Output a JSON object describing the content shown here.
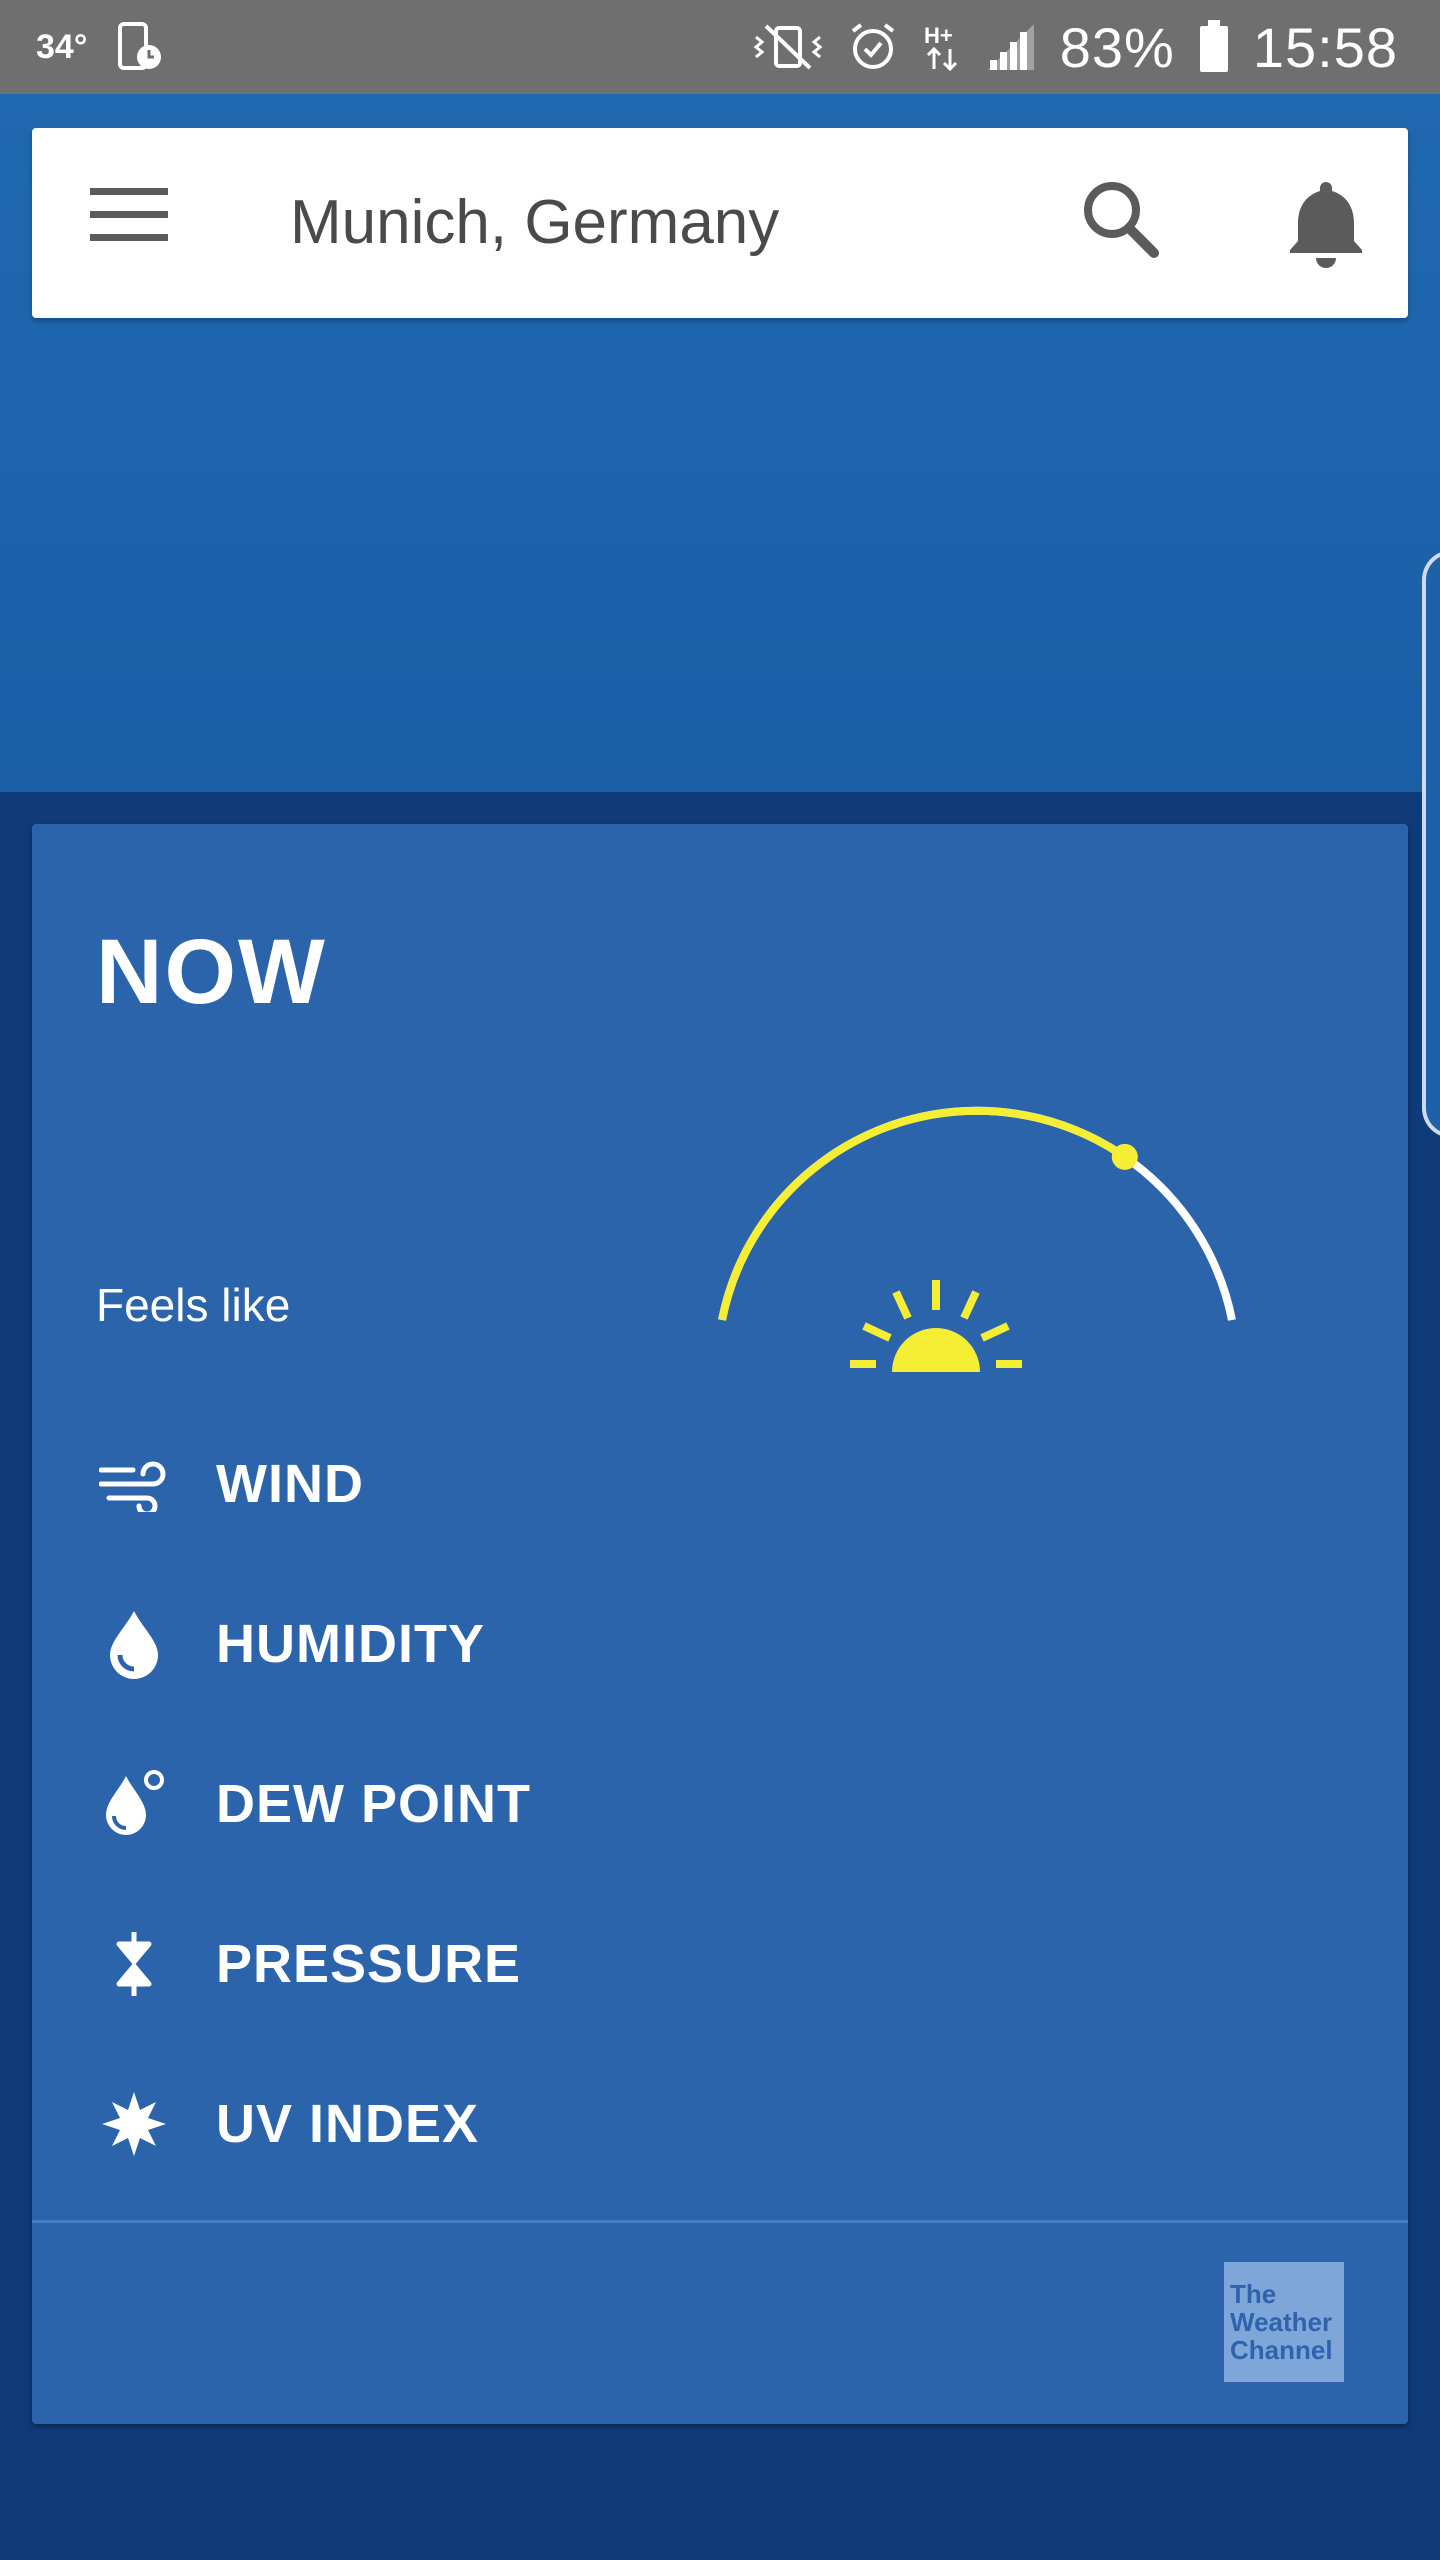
{
  "status_bar": {
    "temperature": "34°",
    "battery_percent": "83%",
    "time": "15:58",
    "network": "H+"
  },
  "search_bar": {
    "location": "Munich, Germany"
  },
  "now_card": {
    "title": "NOW",
    "feels_like_label": "Feels like",
    "details": [
      {
        "label": "WIND",
        "icon": "wind-icon"
      },
      {
        "label": "HUMIDITY",
        "icon": "humidity-drop-icon"
      },
      {
        "label": "DEW POINT",
        "icon": "dew-point-icon"
      },
      {
        "label": "PRESSURE",
        "icon": "pressure-icon"
      },
      {
        "label": "UV INDEX",
        "icon": "uv-index-icon"
      }
    ],
    "sun_progress": 0.72
  },
  "footer": {
    "logo_lines": [
      "The",
      "Weather",
      "Channel"
    ]
  },
  "colors": {
    "hero_blue": "#1f69b0",
    "card_blue": "#2b64ab",
    "page_dark_blue": "#0f3b78",
    "sun_yellow": "#f5ee34",
    "status_gray": "#6f6f6f"
  }
}
